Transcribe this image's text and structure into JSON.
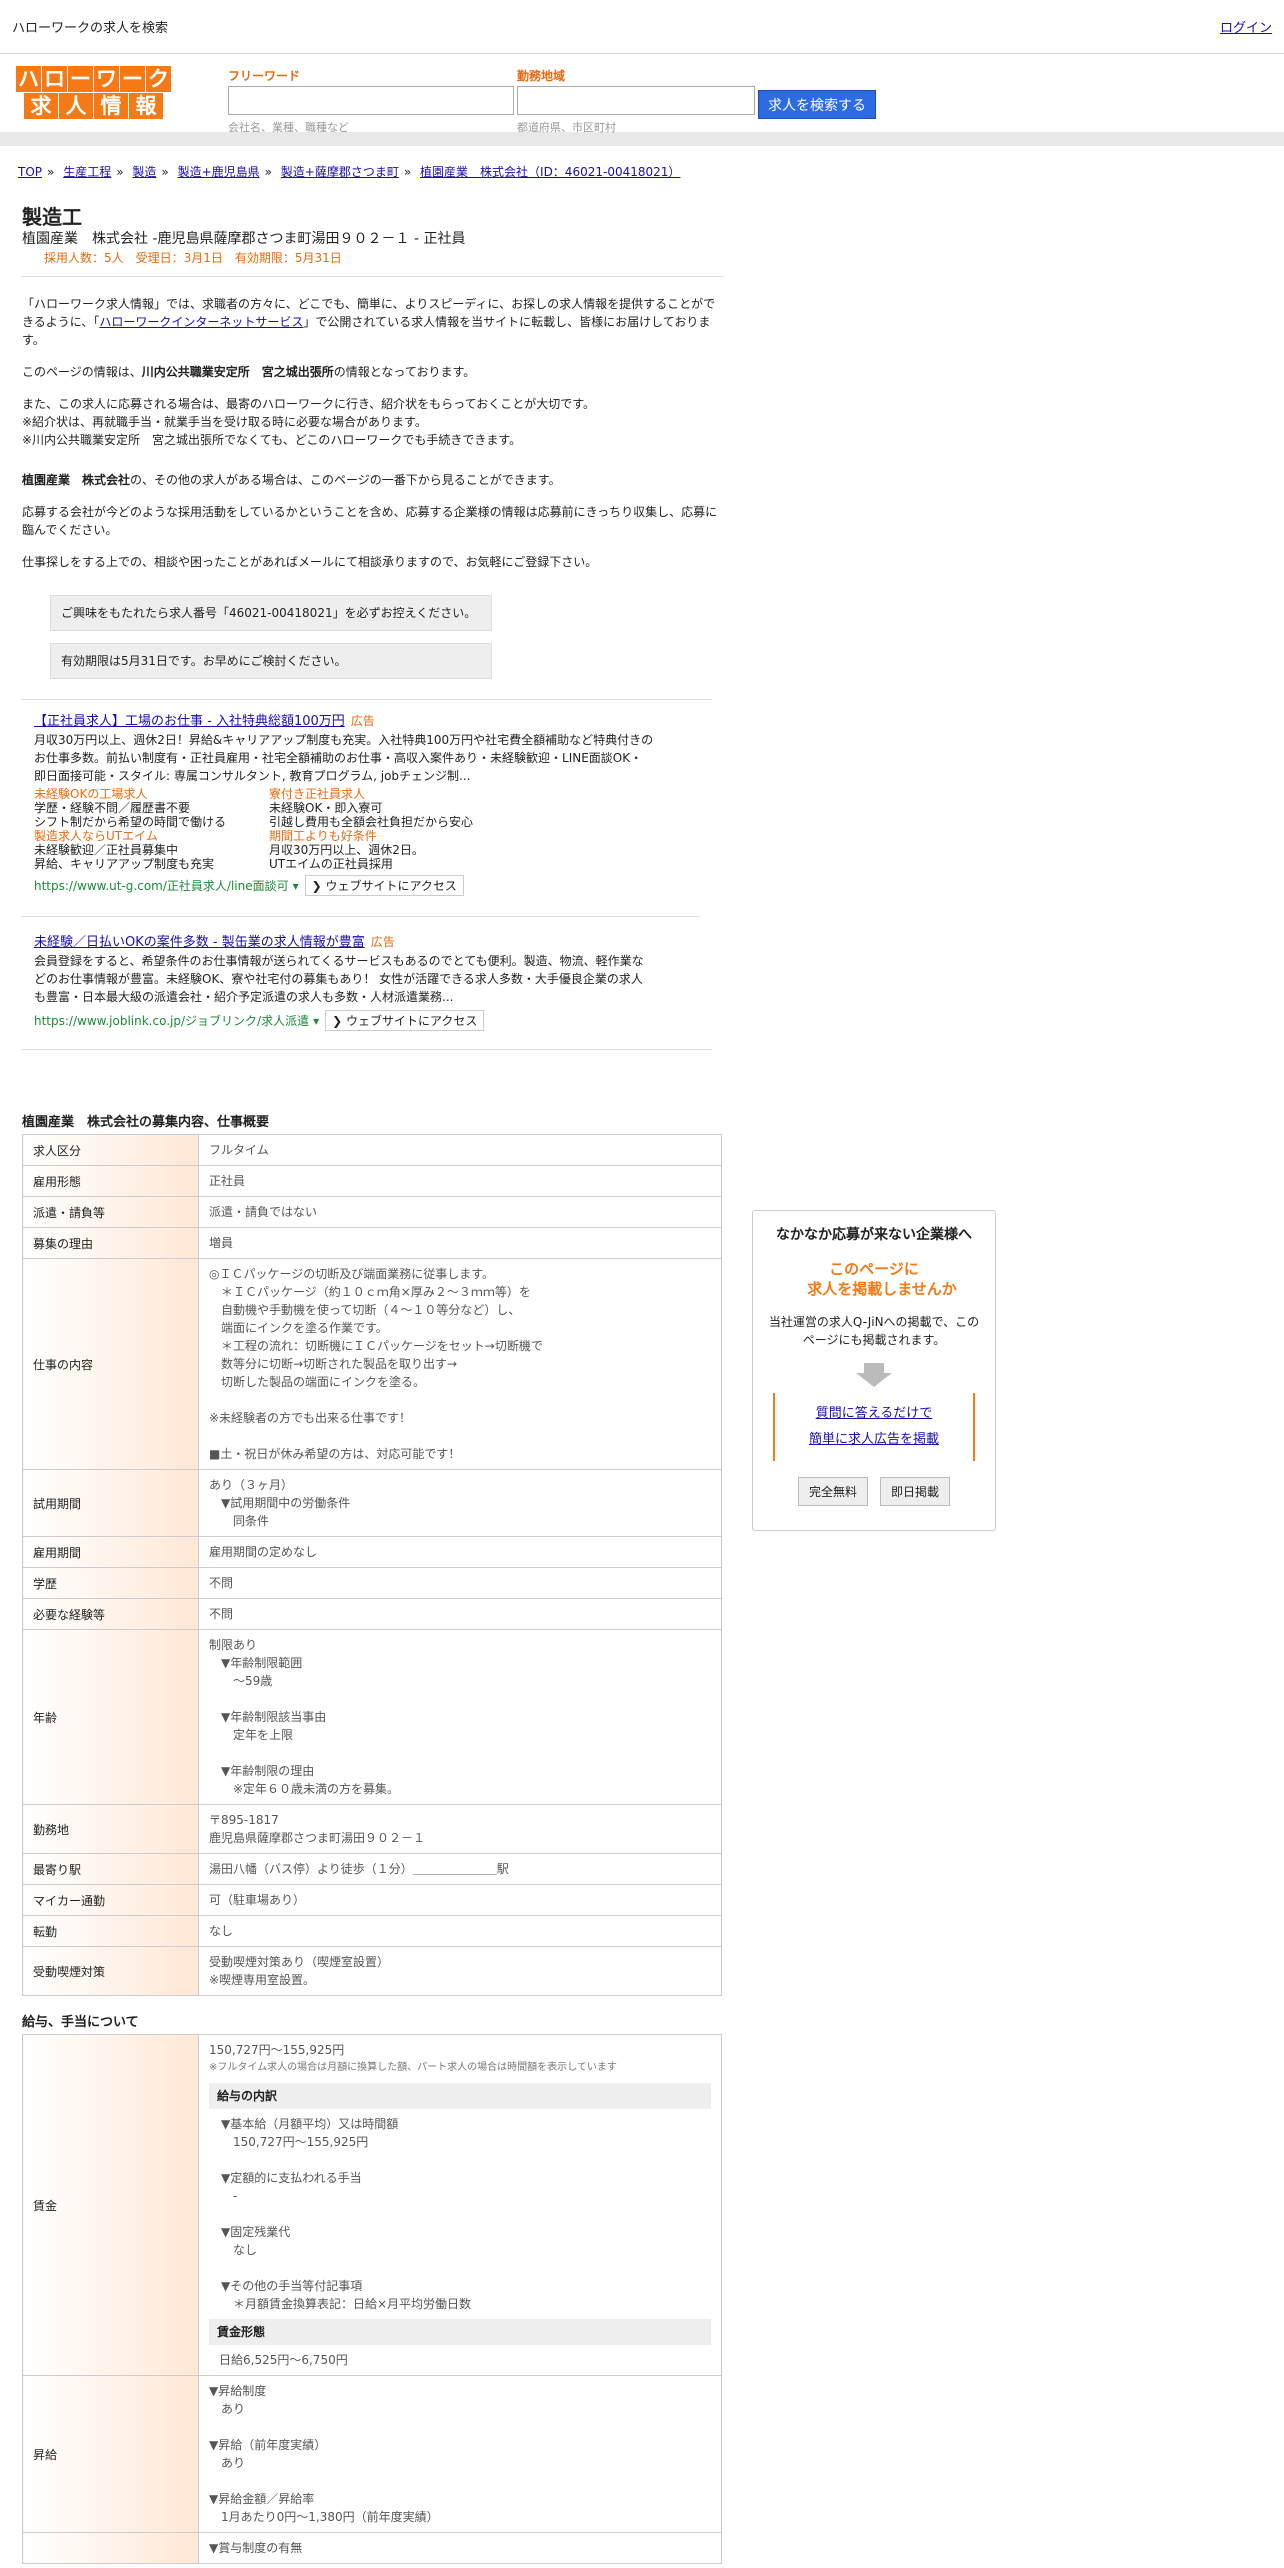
{
  "topbar": {
    "title": "ハローワークの求人を検索",
    "login": "ログイン"
  },
  "logo": {
    "row1": [
      "ハ",
      "ロ",
      "ー",
      "ワ",
      "ー",
      "ク"
    ],
    "row2": [
      "求",
      "人",
      "情",
      "報"
    ]
  },
  "search": {
    "keyword_label": "フリーワード",
    "keyword_hint": "会社名、業種、職種など",
    "area_label": "勤務地域",
    "area_hint": "都道府県、市区町村",
    "button": "求人を検索する"
  },
  "breadcrumb": [
    "TOP",
    "生産工程",
    "製造",
    "製造+鹿児島県",
    "製造+薩摩郡さつま町",
    "植園産業　株式会社（ID：46021-00418021）"
  ],
  "job": {
    "title": "製造工",
    "subtitle": "植園産業　株式会社 -鹿児島県薩摩郡さつま町湯田９０２－１ - 正社員",
    "meta": "採用人数：5人　受理日：3月1日　有効期限：5月31日"
  },
  "intro": {
    "p1a": "「ハローワーク求人情報」では、求職者の方々に、どこでも、簡単に、よりスピーディに、お探しの求人情報を提供することができるように、「",
    "p1link": "ハローワークインターネットサービス",
    "p1b": "」で公開されている求人情報を当サイトに転載し、皆様にお届けしております。",
    "p2a": "このページの情報は、",
    "p2b": "川内公共職業安定所　宮之城出張所",
    "p2c": "の情報となっております。",
    "p3": "また、この求人に応募される場合は、最寄のハローワークに行き、紹介状をもらっておくことが大切です。\n※紹介状は、再就職手当・就業手当を受け取る時に必要な場合があります。\n※川内公共職業安定所　宮之城出張所でなくても、どこのハローワークでも手続きできます。",
    "p4a": "植園産業　株式会社",
    "p4b": "の、その他の求人がある場合は、このページの一番下から見ることができます。",
    "p5": "応募する会社が今どのような採用活動をしているかということを含め、応募する企業様の情報は応募前にきっちり収集し、応募に臨んでください。",
    "p6": "仕事探しをする上での、相談や困ったことがあればメールにて相談承りますので、お気軽にご登録下さい。"
  },
  "notices": [
    "ご興味をもたれたら求人番号「46021-00418021」を必ずお控えください。",
    "有効期限は5月31日です。お早めにご検討ください。"
  ],
  "ads": [
    {
      "title": "【正社員求人】工場のお仕事 - 入社特典総額100万円",
      "tag": "広告",
      "desc": "月収30万円以上、週休2日！昇給&キャリアアップ制度も充実。入社特典100万円や社宅費全額補助など特典付きのお仕事多数。前払い制度有・正社員雇用・社宅全額補助のお仕事・高収入案件あり・未経験歓迎・LINE面談OK・即日面接可能・スタイル: 専属コンサルタント, 教育プログラム, jobチェンジ制...",
      "links": [
        {
          "t": "未経験OKの工場求人",
          "d": "学歴・経験不問／履歴書不要\nシフト制だから希望の時間で働ける"
        },
        {
          "t": "寮付き正社員求人",
          "d": "未経験OK・即入寮可\n引越し費用も全額会社負担だから安心"
        },
        {
          "t": "製造求人ならUTエイム",
          "d": "未経験歓迎／正社員募集中\n昇給、キャリアアップ制度も充実"
        },
        {
          "t": "期間工よりも好条件",
          "d": "月収30万円以上、週休2日。\nUTエイムの正社員採用"
        }
      ],
      "url": "https://www.ut-g.com/正社員求人/line面談可",
      "button": "❯ ウェブサイトにアクセス"
    },
    {
      "title": "未経験／日払いOKの案件多数 - 製缶業の求人情報が豊富",
      "tag": "広告",
      "desc": "会員登録をすると、希望条件のお仕事情報が送られてくるサービスもあるのでとても便利。製造、物流、軽作業などのお仕事情報が豊富。未経験OK、寮や社宅付の募集もあり！ 女性が活躍できる求人多数・大手優良企業の求人も豊富・日本最大級の派遣会社・紹介予定派遣の求人も多数・人材派遣業務...",
      "links": [],
      "url": "https://www.joblink.co.jp/ジョブリンク/求人派遣",
      "button": "❯ ウェブサイトにアクセス"
    }
  ],
  "recruit": {
    "title": "植園産業　株式会社の募集内容、仕事概要",
    "rows": [
      {
        "k": "求人区分",
        "v": "フルタイム"
      },
      {
        "k": "雇用形態",
        "v": "正社員"
      },
      {
        "k": "派遣・請負等",
        "v": "派遣・請負ではない"
      },
      {
        "k": "募集の理由",
        "v": "増員"
      },
      {
        "k": "仕事の内容",
        "v": "◎ＩＣパッケージの切断及び端面業務に従事します。\n　＊ＩＣパッケージ（約１０ｃｍ角×厚み２～３ｍｍ等）を\n　自動機や手動機を使って切断（４～１０等分など）し、\n　端面にインクを塗る作業です。\n　＊工程の流れ：切断機にＩＣパッケージをセット→切断機で\n　数等分に切断→切断された製品を取り出す→\n　切断した製品の端面にインクを塗る。\n\n※未経験者の方でも出来る仕事です！\n\n■土・祝日が休み希望の方は、対応可能です！"
      },
      {
        "k": "試用期間",
        "v": "あり（３ヶ月）\n　▼試用期間中の労働条件\n　　同条件"
      },
      {
        "k": "雇用期間",
        "v": "雇用期間の定めなし"
      },
      {
        "k": "学歴",
        "v": "不問"
      },
      {
        "k": "必要な経験等",
        "v": "不問"
      },
      {
        "k": "年齢",
        "v": "制限あり\n　▼年齢制限範囲\n　　～59歳\n\n　▼年齢制限該当事由\n　　定年を上限\n\n　▼年齢制限の理由\n　　※定年６０歳未満の方を募集。"
      },
      {
        "k": "勤務地",
        "v": "〒895-1817\n鹿児島県薩摩郡さつま町湯田９０２－１"
      },
      {
        "k": "最寄り駅",
        "v": "湯田八幡（バス停）より徒歩（１分）＿＿＿＿＿＿＿駅"
      },
      {
        "k": "マイカー通勤",
        "v": "可（駐車場あり）"
      },
      {
        "k": "転勤",
        "v": "なし"
      },
      {
        "k": "受動喫煙対策",
        "v": "受動喫煙対策あり（喫煙室設置）\n※喫煙専用室設置。"
      }
    ]
  },
  "salary": {
    "title": "給与、手当について",
    "wage_label": "賃金",
    "wage_range": "150,727円〜155,925円",
    "wage_note": "※フルタイム求人の場合は月額に換算した額、パート求人の場合は時間額を表示しています",
    "breakdown_head": "給与の内訳",
    "breakdown": "　▼基本給（月額平均）又は時間額\n　　150,727円〜155,925円\n\n　▼定額的に支払われる手当\n　　-\n\n　▼固定残業代\n　　なし\n\n　▼その他の手当等付記事項\n　　＊月額賃金換算表記：日給×月平均労働日数",
    "form_head": "賃金形態",
    "form": "日給6,525円〜6,750円",
    "raise_label": "昇給",
    "raise": "▼昇給制度\n　あり\n\n▼昇給（前年度実績）\n　あり\n\n▼昇給金額／昇給率\n　1月あたり0円〜1,380円（前年度実績）",
    "bonus_label": "",
    "bonus": "▼賞与制度の有無"
  },
  "sidebox": {
    "title": "なかなか応募が来ない企業様へ",
    "catch1": "このページに",
    "catch2": "求人を掲載しませんか",
    "desc": "当社運営の求人Q-JiNへの掲載で、このページにも掲載されます。",
    "link1": "質問に答えるだけで",
    "link2": "簡単に求人広告を掲載",
    "btn1": "完全無料",
    "btn2": "即日掲載"
  }
}
